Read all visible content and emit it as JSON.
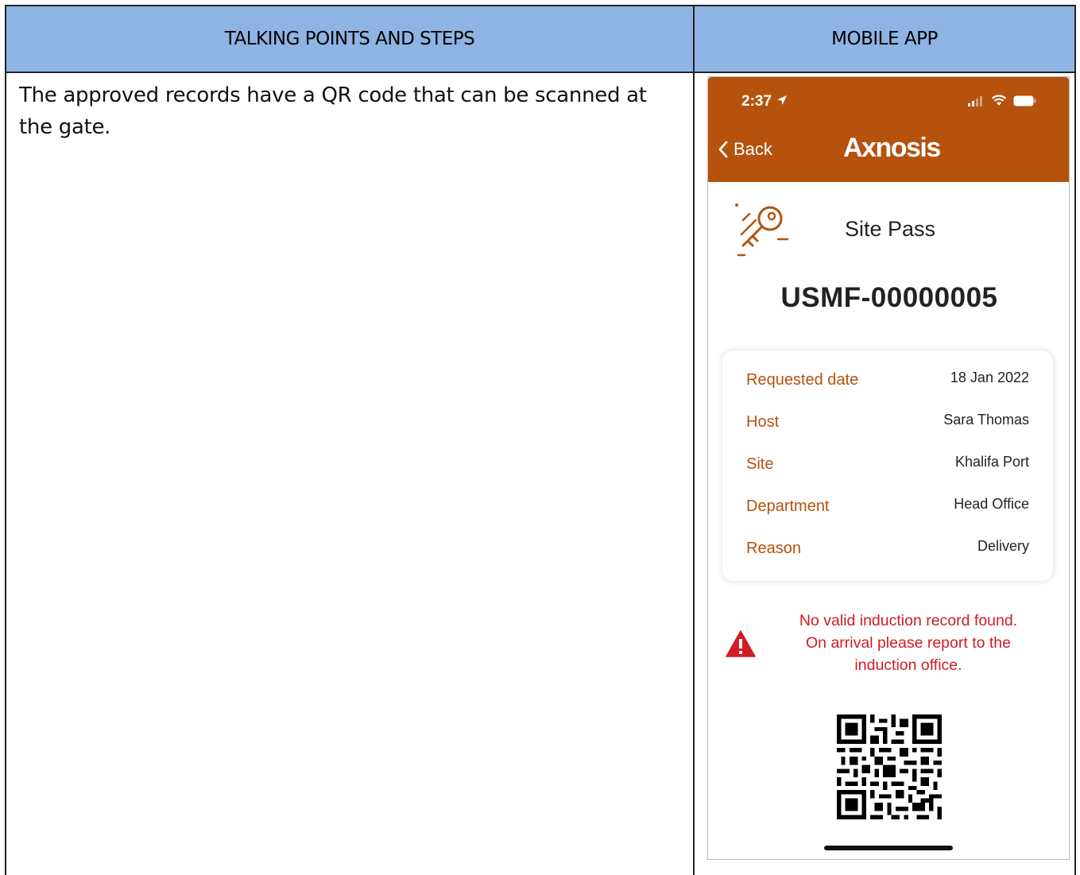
{
  "table": {
    "header_left": "TALKING POINTS AND STEPS",
    "header_right": "MOBILE APP",
    "body_text": "The approved records have a QR code that can be scanned at the gate."
  },
  "app": {
    "status_time": "2:37",
    "back_label": "Back",
    "logo_text": "Axnosis",
    "brand_color": "#b5520d",
    "pass_title": "Site Pass",
    "pass_number": "USMF-00000005",
    "details": [
      {
        "label": "Requested date",
        "value": "18 Jan 2022"
      },
      {
        "label": "Host",
        "value": "Sara Thomas"
      },
      {
        "label": "Site",
        "value": "Khalifa Port"
      },
      {
        "label": "Department",
        "value": "Head Office"
      },
      {
        "label": "Reason",
        "value": "Delivery"
      }
    ],
    "warning_line1": "No valid induction record found.",
    "warning_line2": "On arrival please report to the",
    "warning_line3": "induction office.",
    "warning_color": "#d01c24",
    "icons": [
      "location-arrow-icon",
      "signal-icon",
      "wifi-icon",
      "battery-icon",
      "chevron-left-icon",
      "key-icon",
      "warning-icon",
      "qr-code"
    ]
  }
}
